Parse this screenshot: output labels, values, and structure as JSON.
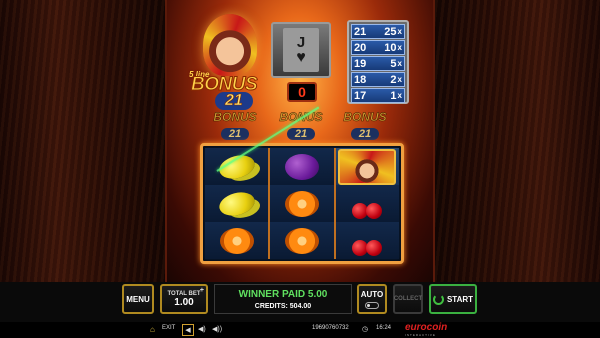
{
  "logo": {
    "lines_label": "5 line",
    "bonus_label": "BONUS",
    "number": "21"
  },
  "card": {
    "rank": "J",
    "suit_icon": "heart-icon",
    "suit_glyph": "♥"
  },
  "counter_value": "0",
  "paytable": [
    {
      "count": "21",
      "multiplier": "25",
      "suffix": "x"
    },
    {
      "count": "20",
      "multiplier": "10",
      "suffix": "x"
    },
    {
      "count": "19",
      "multiplier": "5",
      "suffix": "x"
    },
    {
      "count": "18",
      "multiplier": "2",
      "suffix": "x"
    },
    {
      "count": "17",
      "multiplier": "1",
      "suffix": "x"
    }
  ],
  "mini_bonus": [
    {
      "text": "BONUS",
      "number": "21"
    },
    {
      "text": "BONUS",
      "number": "21"
    },
    {
      "text": "BONUS",
      "number": "21"
    }
  ],
  "reels": [
    [
      "lemon",
      "lemon",
      "orange"
    ],
    [
      "plum",
      "orange",
      "orange"
    ],
    [
      "jester",
      "cherry",
      "cherry"
    ]
  ],
  "controls": {
    "menu_label": "MENU",
    "total_bet_label": "TOTAL BET",
    "total_bet_value": "1.00",
    "bet_plus": "+",
    "winner_text": "WINNER PAID 5.00",
    "credits_text": "CREDITS: 504.00",
    "auto_label": "AUTO",
    "collect_label": "COLLECT",
    "start_label": "START"
  },
  "status": {
    "exit_label": "EXIT",
    "ticket_id": "19690760732",
    "time": "16:24",
    "brand_name": "eurocoin",
    "brand_sub": "INTERACTIVE"
  },
  "colors": {
    "win_green": "#60e060",
    "accent_gold": "#b08a20",
    "start_green": "#3ab040",
    "counter_red": "#ff3a1a"
  }
}
